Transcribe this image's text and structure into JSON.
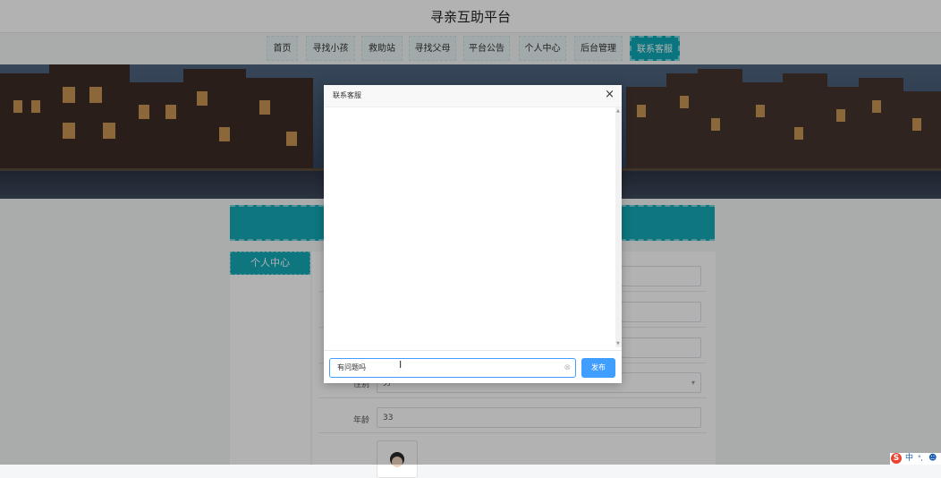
{
  "header": {
    "title": "寻亲互助平台"
  },
  "nav": {
    "items": [
      {
        "label": "首页"
      },
      {
        "label": "寻找小孩"
      },
      {
        "label": "救助站"
      },
      {
        "label": "寻找父母"
      },
      {
        "label": "平台公告"
      },
      {
        "label": "个人中心"
      },
      {
        "label": "后台管理"
      },
      {
        "label": "联系客服"
      }
    ],
    "active": "联系客服"
  },
  "sidebar": {
    "tab_label": "个人中心"
  },
  "form": {
    "fields": [
      {
        "label": "",
        "value": ""
      },
      {
        "label": "",
        "value": ""
      },
      {
        "label": "",
        "value": ""
      },
      {
        "label": "性别",
        "value": "男"
      },
      {
        "label": "年龄",
        "value": "33"
      }
    ]
  },
  "dialog": {
    "title": "联系客服",
    "close_icon": "close-icon",
    "message_input": {
      "value": "有问题吗"
    },
    "send_label": "发布"
  },
  "ime": {
    "logo": "S",
    "lang": "中"
  },
  "colors": {
    "accent": "#14a9b7",
    "primary_button": "#409eff"
  }
}
